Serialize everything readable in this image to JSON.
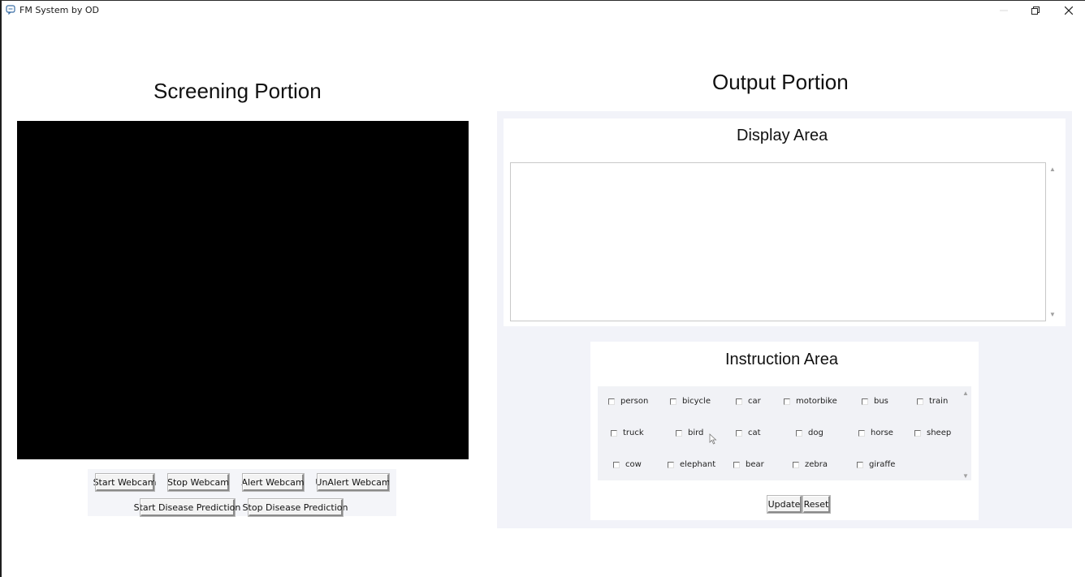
{
  "window": {
    "title": "FM System by OD",
    "minimize_icon": "minimize-icon",
    "maximize_icon": "restore-icon",
    "close_icon": "close-icon"
  },
  "screening": {
    "title": "Screening Portion",
    "buttons": {
      "start_webcam": "Start Webcam",
      "stop_webcam": "Stop Webcam",
      "alert_webcam": "Alert Webcam",
      "unalert_webcam": "UnAlert Webcam",
      "start_disease": "Start Disease Prediction",
      "stop_disease": "Stop Disease Prediction"
    }
  },
  "output": {
    "title": "Output Portion",
    "display_title": "Display Area",
    "display_text": "",
    "instruction_title": "Instruction Area",
    "classes": [
      "person",
      "bicycle",
      "car",
      "motorbike",
      "bus",
      "train",
      "truck",
      "bird",
      "cat",
      "dog",
      "horse",
      "sheep",
      "cow",
      "elephant",
      "bear",
      "zebra",
      "giraffe"
    ],
    "buttons": {
      "update": "Update",
      "reset": "Reset"
    }
  }
}
